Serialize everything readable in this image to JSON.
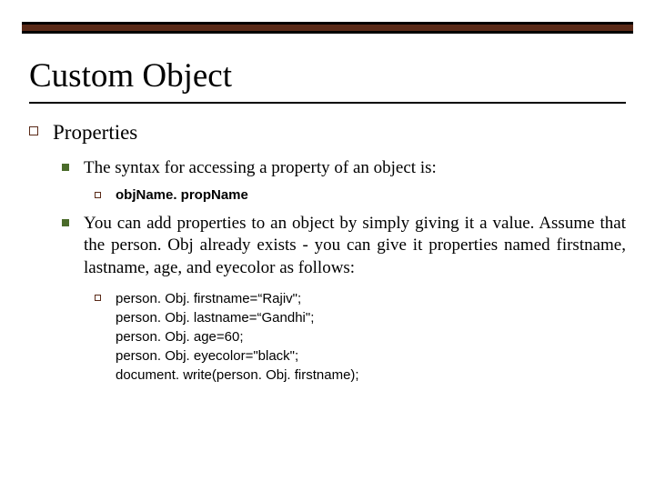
{
  "title": "Custom Object",
  "level1": {
    "label": "Properties"
  },
  "level2": {
    "item1": "The syntax for accessing a property of an object is:",
    "item1_sub": "objName. propName",
    "item2": "You can add properties to an object by simply giving it a value. Assume that the person. Obj already exists - you can give it properties named firstname, lastname, age, and eyecolor as follows:",
    "item2_code": "person. Obj. firstname=“Rajiv\";\nperson. Obj. lastname=“Gandhi\";\nperson. Obj. age=60;\nperson. Obj. eyecolor=\"black\";\ndocument. write(person. Obj. firstname);"
  }
}
